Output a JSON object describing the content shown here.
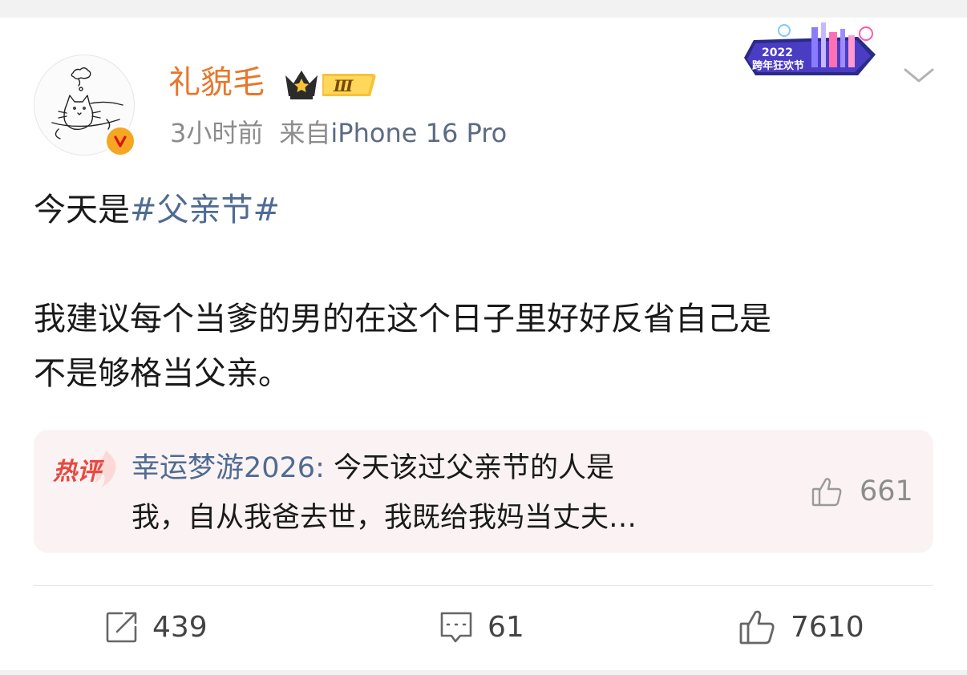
{
  "post": {
    "author": "礼貌毛",
    "vip_level": "Ⅲ",
    "time": "3小时前",
    "source_prefix": "来自",
    "device": "iPhone 16 Pro",
    "event_banner": {
      "year": "2022",
      "text": "跨年狂欢节"
    },
    "content": {
      "line1_prefix": "今天是",
      "hashtag": "#父亲节#",
      "line2": "我建议每个当爹的男的在这个日子里好好反省自己是",
      "line3": "不是够格当父亲。"
    }
  },
  "hot_comment": {
    "label": "热评",
    "commenter": "幸运梦游2026",
    "separator": ": ",
    "text_line1": "今天该过父亲节的人是",
    "text_line2": "我，自从我爸去世，我既给我妈当丈夫…",
    "likes": "661"
  },
  "actions": {
    "repost": "439",
    "comment": "61",
    "like": "7610"
  },
  "colors": {
    "username": "#e8772b",
    "link": "#4f6b93",
    "hot_label": "#e8473e",
    "verified_badge": "#f5a623"
  }
}
